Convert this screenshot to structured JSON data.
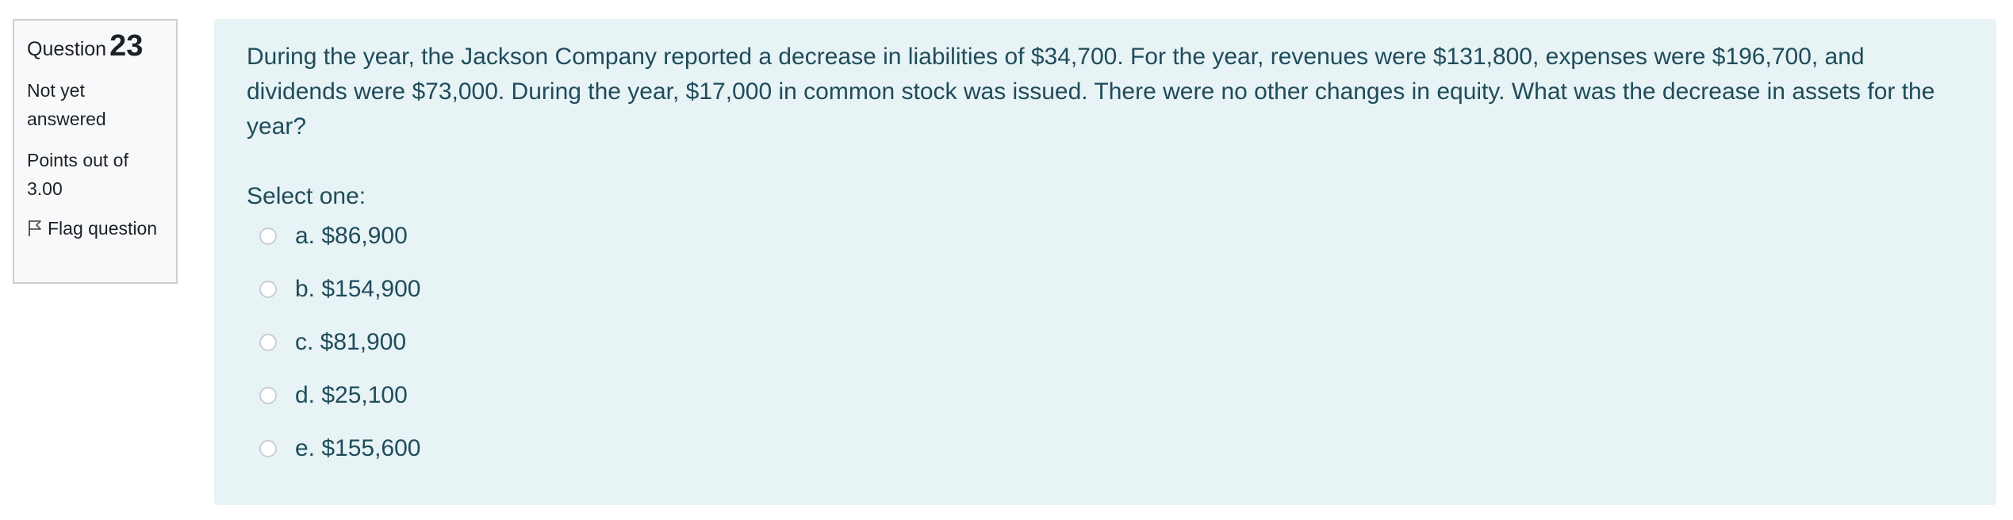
{
  "info": {
    "question_prefix": "Question",
    "question_number": "23",
    "state": "Not yet answered",
    "grade": "Points out of 3.00",
    "flag_label": "Flag question"
  },
  "question": {
    "text": "During the year, the Jackson Company reported a decrease in liabilities of $34,700. For the year, revenues were $131,800, expenses were $196,700, and dividends were $73,000. During the year, $17,000 in common stock was issued. There were no other changes in equity. What was the decrease in assets for the year?",
    "prompt": "Select one:",
    "options": [
      {
        "label": "a. $86,900"
      },
      {
        "label": "b. $154,900"
      },
      {
        "label": "c. $81,900"
      },
      {
        "label": "d. $25,100"
      },
      {
        "label": "e. $155,600"
      }
    ]
  },
  "colors": {
    "content_background": "#e7f3f5",
    "text": "#1f4c5b",
    "info_border": "#cfcfcf"
  }
}
